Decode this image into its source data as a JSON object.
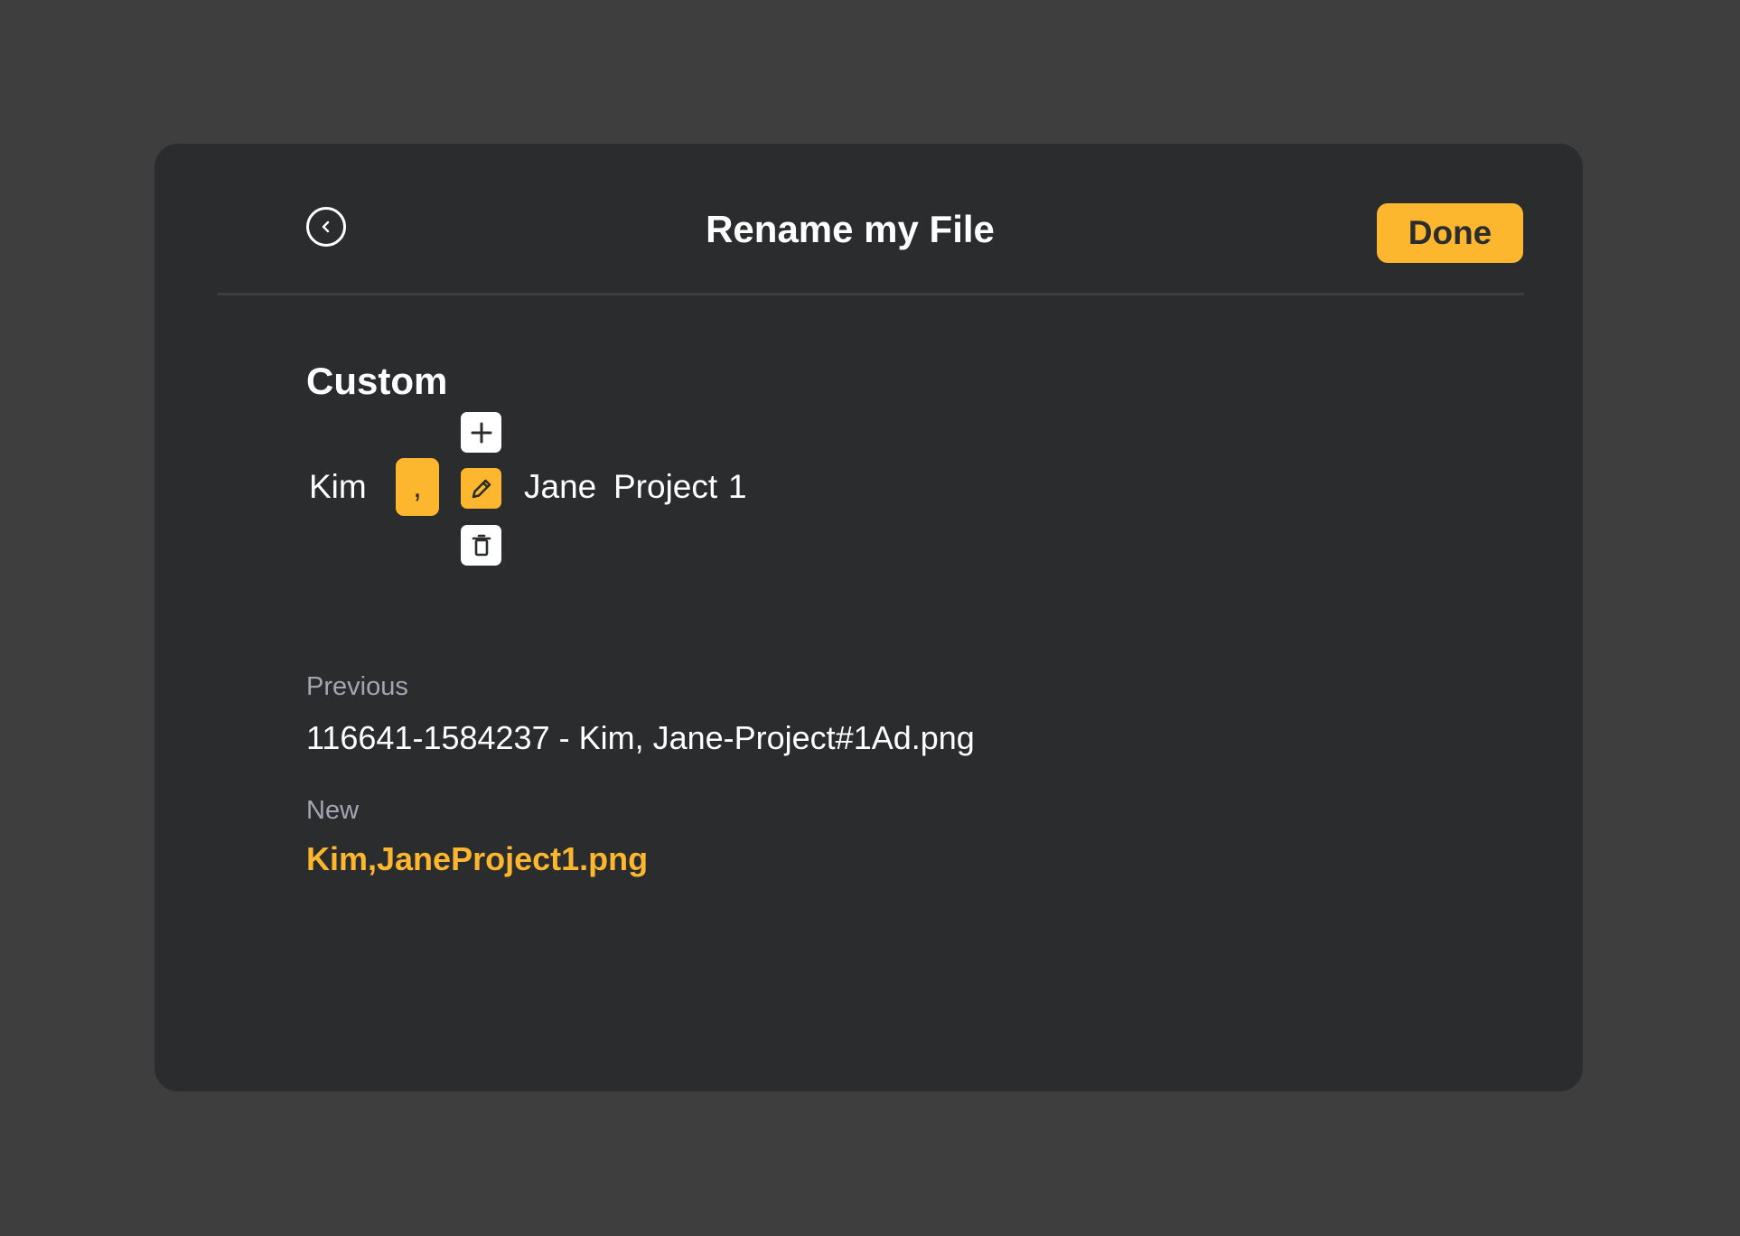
{
  "header": {
    "title": "Rename my File",
    "done_label": "Done"
  },
  "custom": {
    "heading": "Custom",
    "tokens": {
      "first": "Kim",
      "separator": ",",
      "second": "Jane",
      "third": "Project",
      "fourth": "1"
    }
  },
  "preview": {
    "previous_label": "Previous",
    "previous_value": "116641-1584237 - Kim, Jane-Project#1Ad.png",
    "new_label": "New",
    "new_value": "Kim,JaneProject1.png"
  },
  "colors": {
    "accent": "#fdb72e",
    "background": "#3e3e3e",
    "panel": "#2b2c2e",
    "muted": "#a4a5b2"
  },
  "icons": {
    "back": "chevron-left-icon",
    "add": "plus-icon",
    "edit": "pencil-icon",
    "delete": "trash-icon"
  }
}
